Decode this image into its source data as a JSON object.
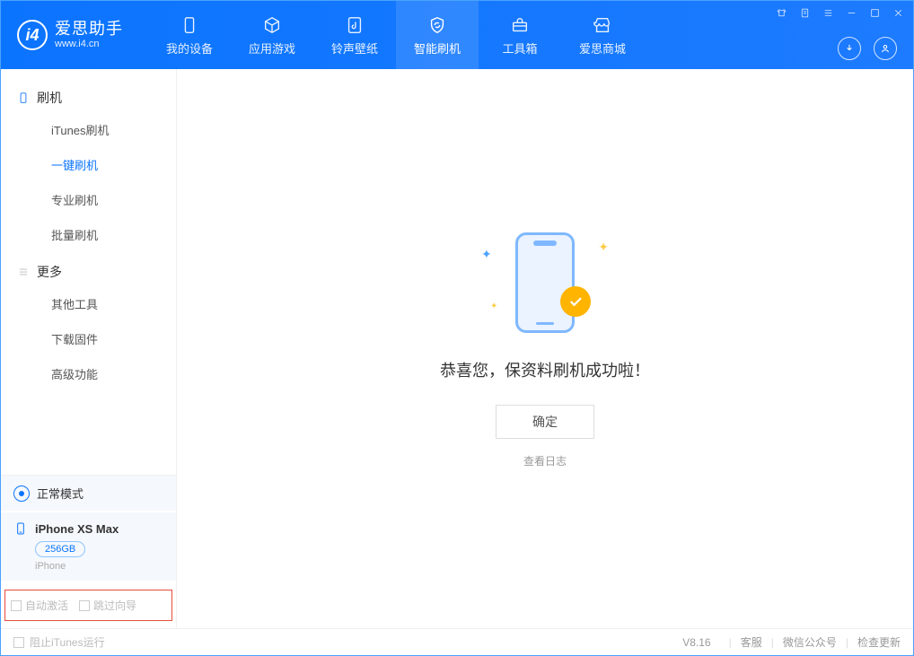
{
  "app": {
    "title": "爱思助手",
    "subtitle": "www.i4.cn"
  },
  "nav": [
    {
      "label": "我的设备"
    },
    {
      "label": "应用游戏"
    },
    {
      "label": "铃声壁纸"
    },
    {
      "label": "智能刷机"
    },
    {
      "label": "工具箱"
    },
    {
      "label": "爱思商城"
    }
  ],
  "sidebar": {
    "group1": {
      "title": "刷机",
      "items": [
        "iTunes刷机",
        "一键刷机",
        "专业刷机",
        "批量刷机"
      ],
      "active_index": 1
    },
    "group2": {
      "title": "更多",
      "items": [
        "其他工具",
        "下载固件",
        "高级功能"
      ]
    }
  },
  "status": {
    "mode": "正常模式"
  },
  "device": {
    "name": "iPhone XS Max",
    "storage": "256GB",
    "type": "iPhone"
  },
  "options": {
    "auto_activate": "自动激活",
    "skip_guide": "跳过向导"
  },
  "main": {
    "success_text": "恭喜您，保资料刷机成功啦！",
    "ok_button": "确定",
    "view_log": "查看日志"
  },
  "footer": {
    "block_itunes": "阻止iTunes运行",
    "version": "V8.16",
    "links": [
      "客服",
      "微信公众号",
      "检查更新"
    ]
  }
}
